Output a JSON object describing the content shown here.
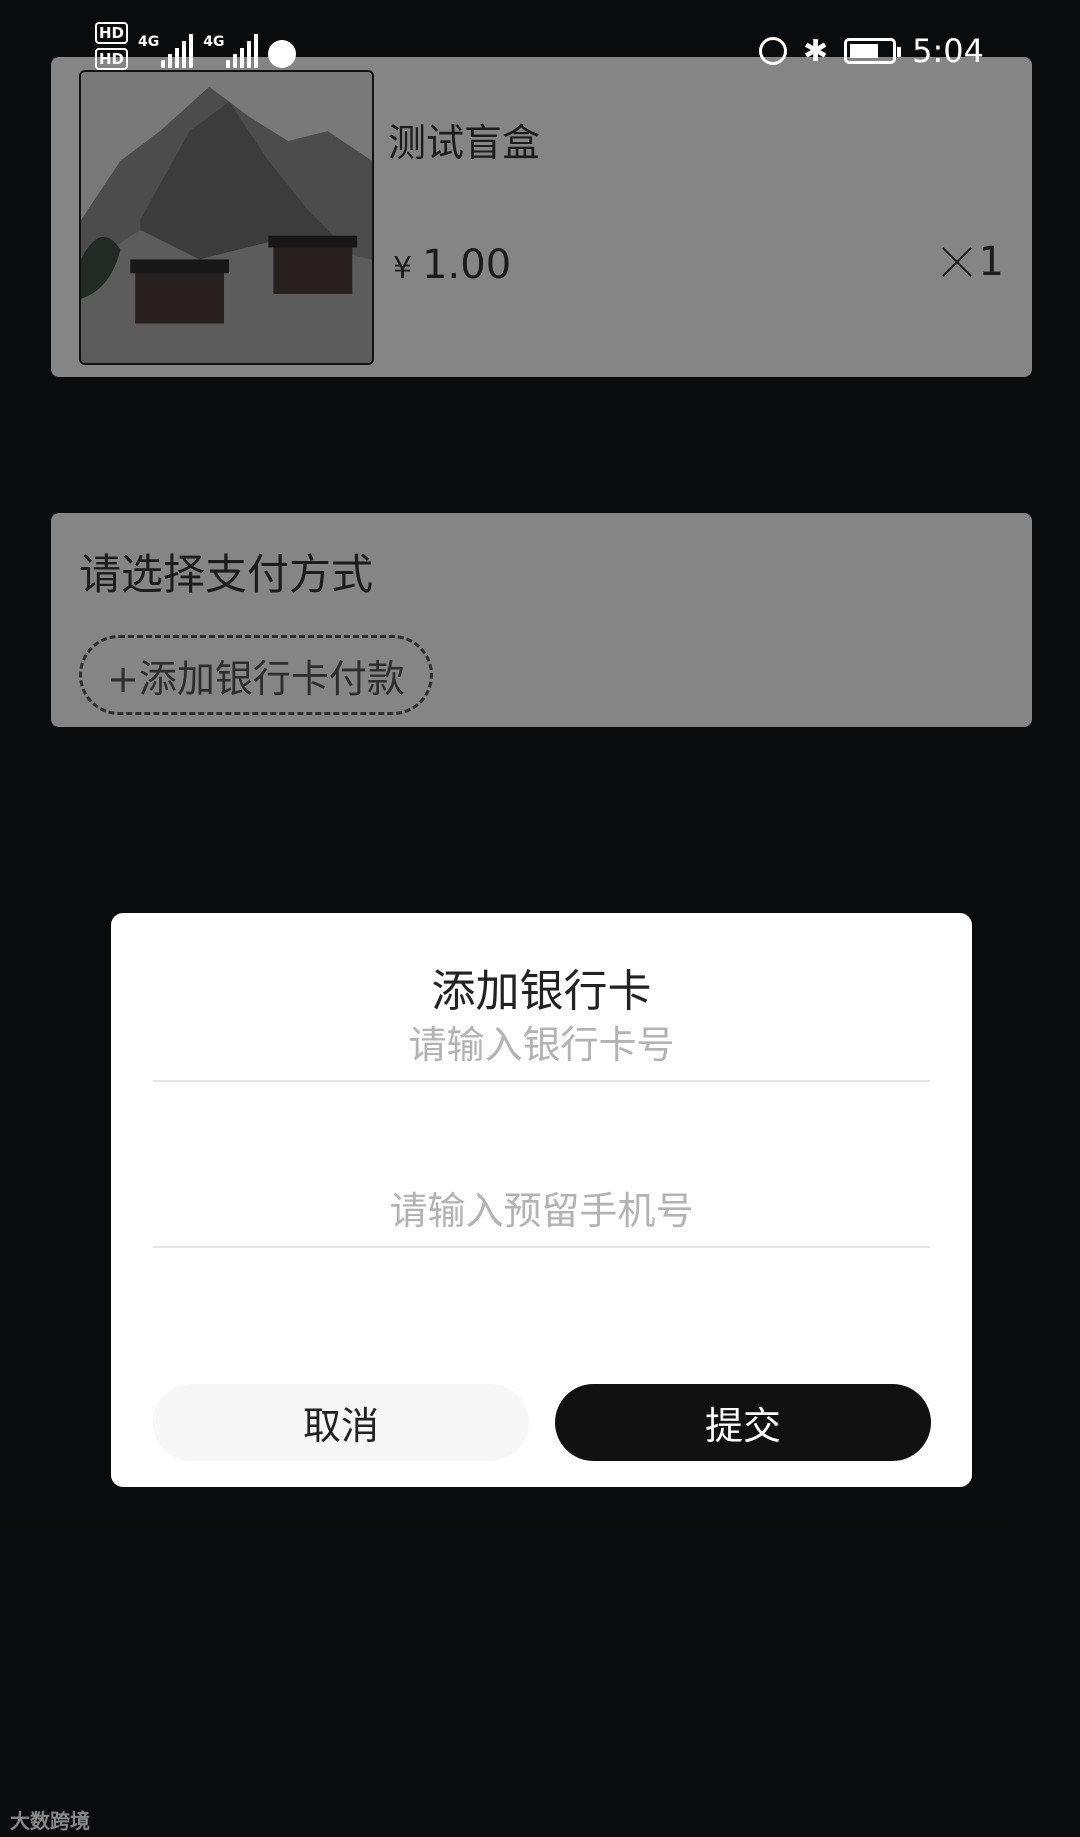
{
  "status_bar": {
    "hd1": "HD",
    "hd2": "HD",
    "sim1_label": "4G",
    "sim2_label": "4G",
    "time": "5:04",
    "icons": [
      "alarm-icon",
      "bluetooth-icon",
      "battery-icon"
    ]
  },
  "product": {
    "name": "测试盲盒",
    "currency": "¥",
    "price": "1.00",
    "quantity": "1"
  },
  "payment": {
    "title": "请选择支付方式",
    "add_card_label": "+添加银行卡付款"
  },
  "dialog": {
    "title": "添加银行卡",
    "card_placeholder": "请输入银行卡号",
    "phone_placeholder": "请输入预留手机号",
    "cancel_label": "取消",
    "submit_label": "提交"
  },
  "watermark": "大数跨境",
  "colors": {
    "background": "#131419",
    "card": "#f2f2f2",
    "submit": "#111111",
    "cancel": "#f7f7f7"
  }
}
